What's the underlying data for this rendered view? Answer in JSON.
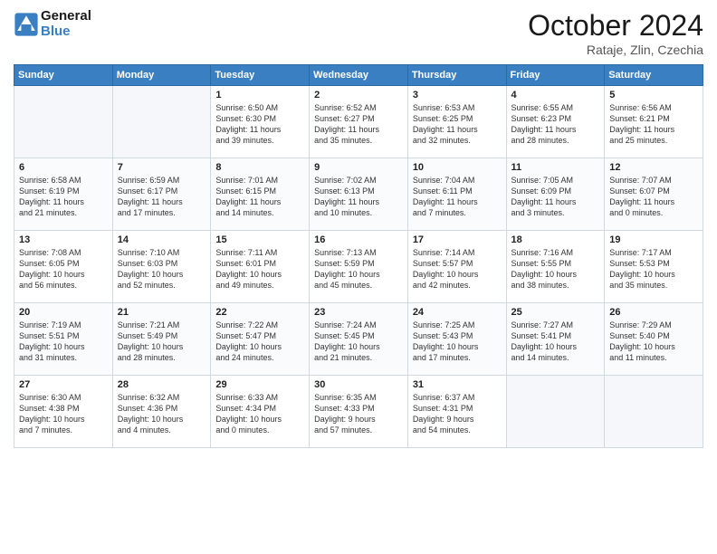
{
  "header": {
    "logo_line1": "General",
    "logo_line2": "Blue",
    "month_title": "October 2024",
    "location": "Rataje, Zlin, Czechia"
  },
  "weekdays": [
    "Sunday",
    "Monday",
    "Tuesday",
    "Wednesday",
    "Thursday",
    "Friday",
    "Saturday"
  ],
  "weeks": [
    [
      {
        "day": "",
        "info": ""
      },
      {
        "day": "",
        "info": ""
      },
      {
        "day": "1",
        "info": "Sunrise: 6:50 AM\nSunset: 6:30 PM\nDaylight: 11 hours\nand 39 minutes."
      },
      {
        "day": "2",
        "info": "Sunrise: 6:52 AM\nSunset: 6:27 PM\nDaylight: 11 hours\nand 35 minutes."
      },
      {
        "day": "3",
        "info": "Sunrise: 6:53 AM\nSunset: 6:25 PM\nDaylight: 11 hours\nand 32 minutes."
      },
      {
        "day": "4",
        "info": "Sunrise: 6:55 AM\nSunset: 6:23 PM\nDaylight: 11 hours\nand 28 minutes."
      },
      {
        "day": "5",
        "info": "Sunrise: 6:56 AM\nSunset: 6:21 PM\nDaylight: 11 hours\nand 25 minutes."
      }
    ],
    [
      {
        "day": "6",
        "info": "Sunrise: 6:58 AM\nSunset: 6:19 PM\nDaylight: 11 hours\nand 21 minutes."
      },
      {
        "day": "7",
        "info": "Sunrise: 6:59 AM\nSunset: 6:17 PM\nDaylight: 11 hours\nand 17 minutes."
      },
      {
        "day": "8",
        "info": "Sunrise: 7:01 AM\nSunset: 6:15 PM\nDaylight: 11 hours\nand 14 minutes."
      },
      {
        "day": "9",
        "info": "Sunrise: 7:02 AM\nSunset: 6:13 PM\nDaylight: 11 hours\nand 10 minutes."
      },
      {
        "day": "10",
        "info": "Sunrise: 7:04 AM\nSunset: 6:11 PM\nDaylight: 11 hours\nand 7 minutes."
      },
      {
        "day": "11",
        "info": "Sunrise: 7:05 AM\nSunset: 6:09 PM\nDaylight: 11 hours\nand 3 minutes."
      },
      {
        "day": "12",
        "info": "Sunrise: 7:07 AM\nSunset: 6:07 PM\nDaylight: 11 hours\nand 0 minutes."
      }
    ],
    [
      {
        "day": "13",
        "info": "Sunrise: 7:08 AM\nSunset: 6:05 PM\nDaylight: 10 hours\nand 56 minutes."
      },
      {
        "day": "14",
        "info": "Sunrise: 7:10 AM\nSunset: 6:03 PM\nDaylight: 10 hours\nand 52 minutes."
      },
      {
        "day": "15",
        "info": "Sunrise: 7:11 AM\nSunset: 6:01 PM\nDaylight: 10 hours\nand 49 minutes."
      },
      {
        "day": "16",
        "info": "Sunrise: 7:13 AM\nSunset: 5:59 PM\nDaylight: 10 hours\nand 45 minutes."
      },
      {
        "day": "17",
        "info": "Sunrise: 7:14 AM\nSunset: 5:57 PM\nDaylight: 10 hours\nand 42 minutes."
      },
      {
        "day": "18",
        "info": "Sunrise: 7:16 AM\nSunset: 5:55 PM\nDaylight: 10 hours\nand 38 minutes."
      },
      {
        "day": "19",
        "info": "Sunrise: 7:17 AM\nSunset: 5:53 PM\nDaylight: 10 hours\nand 35 minutes."
      }
    ],
    [
      {
        "day": "20",
        "info": "Sunrise: 7:19 AM\nSunset: 5:51 PM\nDaylight: 10 hours\nand 31 minutes."
      },
      {
        "day": "21",
        "info": "Sunrise: 7:21 AM\nSunset: 5:49 PM\nDaylight: 10 hours\nand 28 minutes."
      },
      {
        "day": "22",
        "info": "Sunrise: 7:22 AM\nSunset: 5:47 PM\nDaylight: 10 hours\nand 24 minutes."
      },
      {
        "day": "23",
        "info": "Sunrise: 7:24 AM\nSunset: 5:45 PM\nDaylight: 10 hours\nand 21 minutes."
      },
      {
        "day": "24",
        "info": "Sunrise: 7:25 AM\nSunset: 5:43 PM\nDaylight: 10 hours\nand 17 minutes."
      },
      {
        "day": "25",
        "info": "Sunrise: 7:27 AM\nSunset: 5:41 PM\nDaylight: 10 hours\nand 14 minutes."
      },
      {
        "day": "26",
        "info": "Sunrise: 7:29 AM\nSunset: 5:40 PM\nDaylight: 10 hours\nand 11 minutes."
      }
    ],
    [
      {
        "day": "27",
        "info": "Sunrise: 6:30 AM\nSunset: 4:38 PM\nDaylight: 10 hours\nand 7 minutes."
      },
      {
        "day": "28",
        "info": "Sunrise: 6:32 AM\nSunset: 4:36 PM\nDaylight: 10 hours\nand 4 minutes."
      },
      {
        "day": "29",
        "info": "Sunrise: 6:33 AM\nSunset: 4:34 PM\nDaylight: 10 hours\nand 0 minutes."
      },
      {
        "day": "30",
        "info": "Sunrise: 6:35 AM\nSunset: 4:33 PM\nDaylight: 9 hours\nand 57 minutes."
      },
      {
        "day": "31",
        "info": "Sunrise: 6:37 AM\nSunset: 4:31 PM\nDaylight: 9 hours\nand 54 minutes."
      },
      {
        "day": "",
        "info": ""
      },
      {
        "day": "",
        "info": ""
      }
    ]
  ]
}
